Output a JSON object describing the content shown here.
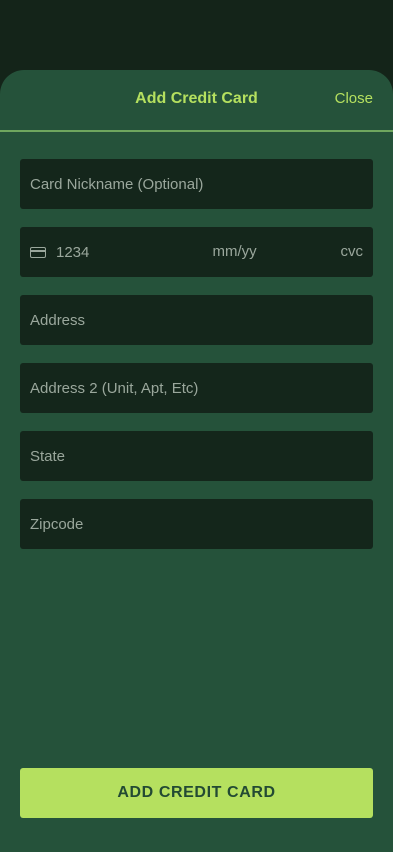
{
  "sheet": {
    "title": "Add Credit Card",
    "close_label": "Close"
  },
  "form": {
    "nickname_placeholder": "Card Nickname (Optional)",
    "card_number_placeholder": "1234",
    "expiry_placeholder": "mm/yy",
    "cvc_placeholder": "cvc",
    "address_placeholder": "Address",
    "address2_placeholder": "Address 2 (Unit, Apt, Etc)",
    "state_placeholder": "State",
    "zipcode_placeholder": "Zipcode"
  },
  "actions": {
    "submit_label": "ADD CREDIT CARD"
  },
  "colors": {
    "accent": "#b5e05f",
    "sheet_bg": "#25523a",
    "field_bg": "#14261b",
    "backdrop": "#142419"
  },
  "icons": {
    "card": "credit-card-icon"
  }
}
